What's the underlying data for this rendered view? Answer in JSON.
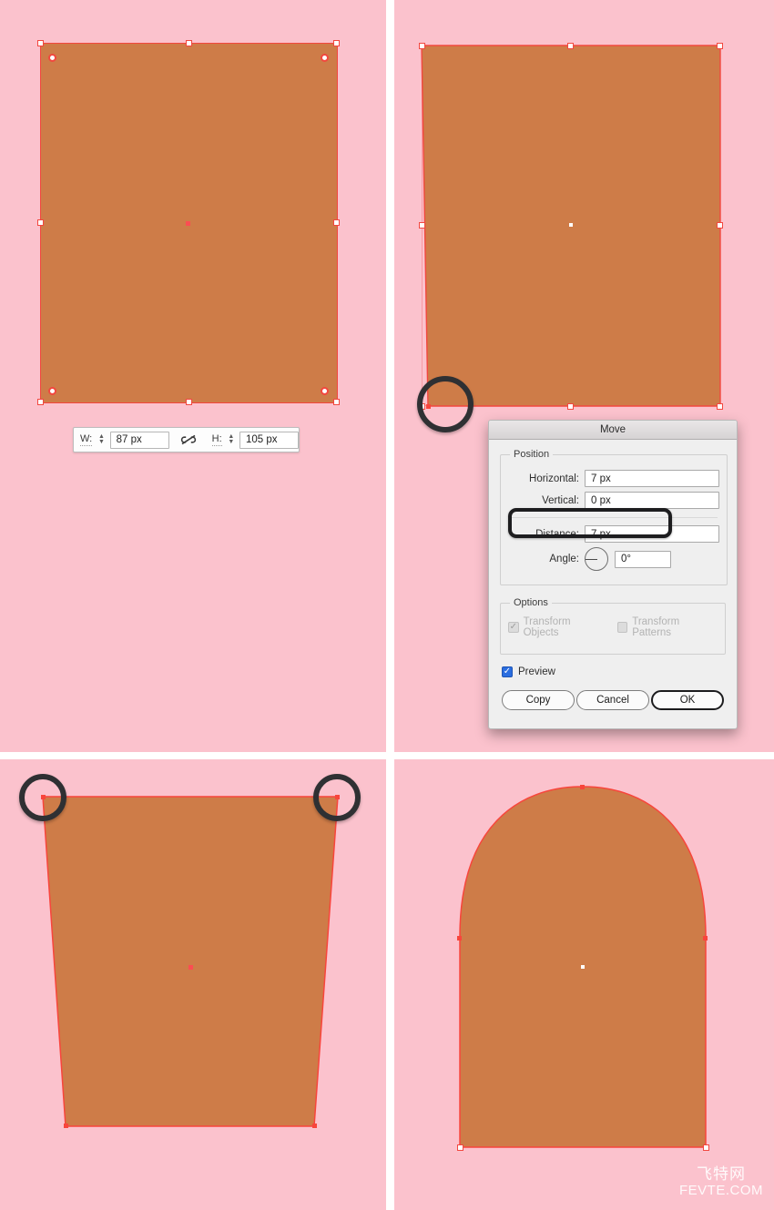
{
  "app": {
    "background_color": "#fbc2cd",
    "shape_fill_color": "#ce7c48",
    "stroke_color": "#f2473f",
    "accent_color": "#2a6de0",
    "annotation_ring_color": "#2f3033"
  },
  "panels": [
    {
      "id": "panel-1",
      "caption": "rectangle with live corner widgets selected"
    },
    {
      "id": "panel-2",
      "caption": "bottom-left anchor moved 7 px right"
    },
    {
      "id": "panel-3",
      "caption": "trapezoid with both top corners highlighted"
    },
    {
      "id": "panel-4",
      "caption": "arch shape with rounded top"
    }
  ],
  "transform_toolbar": {
    "width_label": "W:",
    "width_value": "87 px",
    "link_icon": "broken-link-icon",
    "height_label": "H:",
    "height_value": "105 px"
  },
  "move_dialog": {
    "title": "Move",
    "position_group": {
      "legend": "Position",
      "horizontal_label": "Horizontal:",
      "horizontal_value": "7 px",
      "vertical_label": "Vertical:",
      "vertical_value": "0 px",
      "distance_label": "Distance:",
      "distance_value": "7 px",
      "angle_label": "Angle:",
      "angle_value": "0°"
    },
    "options_group": {
      "legend": "Options",
      "transform_objects_label": "Transform Objects",
      "transform_objects_checked": true,
      "transform_patterns_label": "Transform Patterns",
      "transform_patterns_checked": false
    },
    "preview_label": "Preview",
    "preview_checked": true,
    "buttons": {
      "copy": "Copy",
      "cancel": "Cancel",
      "ok": "OK"
    }
  },
  "watermark": {
    "chinese": "飞特网",
    "latin": "FEVTE.COM"
  }
}
